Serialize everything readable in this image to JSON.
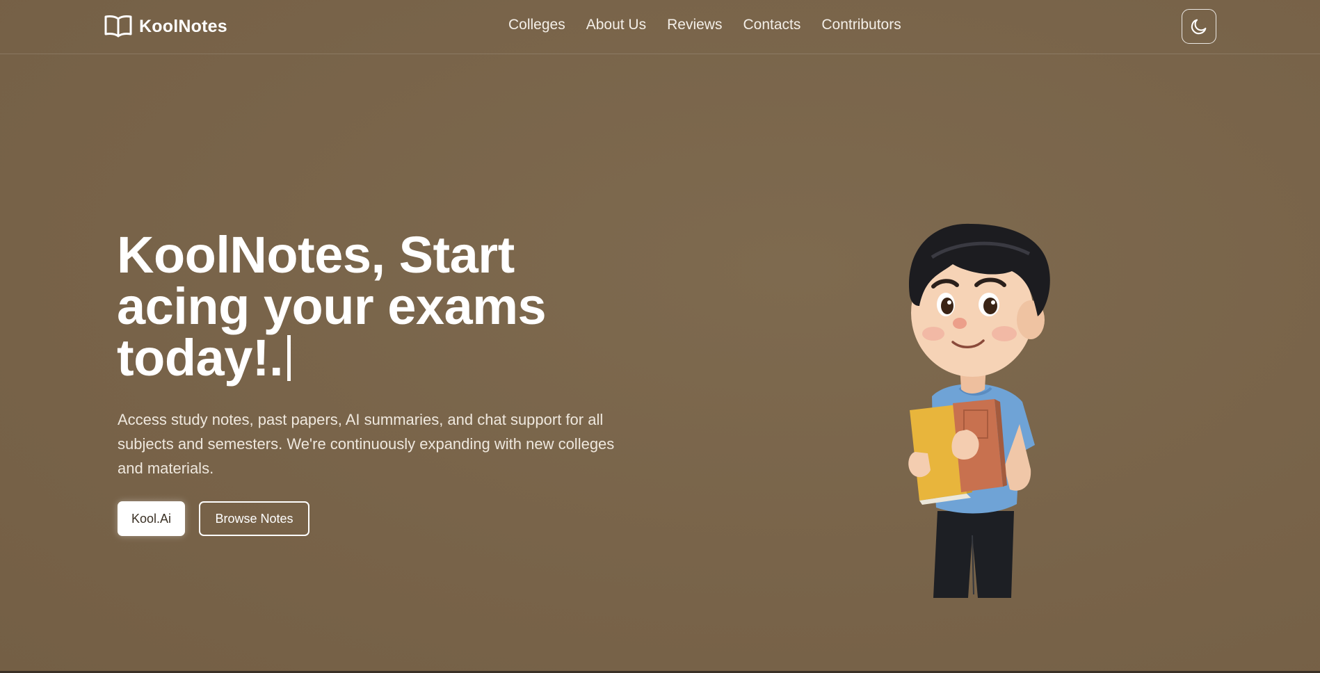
{
  "brand": {
    "name": "KoolNotes",
    "icon": "open-book-icon"
  },
  "nav": {
    "links": [
      "Colleges",
      "About Us",
      "Reviews",
      "Contacts",
      "Contributors"
    ]
  },
  "theme_toggle": {
    "icon": "moon-icon"
  },
  "hero": {
    "title": "KoolNotes, Start acing your exams today!.",
    "description": "Access study notes, past papers, AI summaries, and chat support for all subjects and semesters. We're continuously expanding with new colleges and materials.",
    "primary_button": "Kool.Ai",
    "secondary_button": "Browse Notes"
  },
  "illustration": {
    "subject": "cartoon-boy-holding-books"
  },
  "colors": {
    "background": "#79644a",
    "text": "#ffffff",
    "primary_button_bg": "#ffffff"
  }
}
